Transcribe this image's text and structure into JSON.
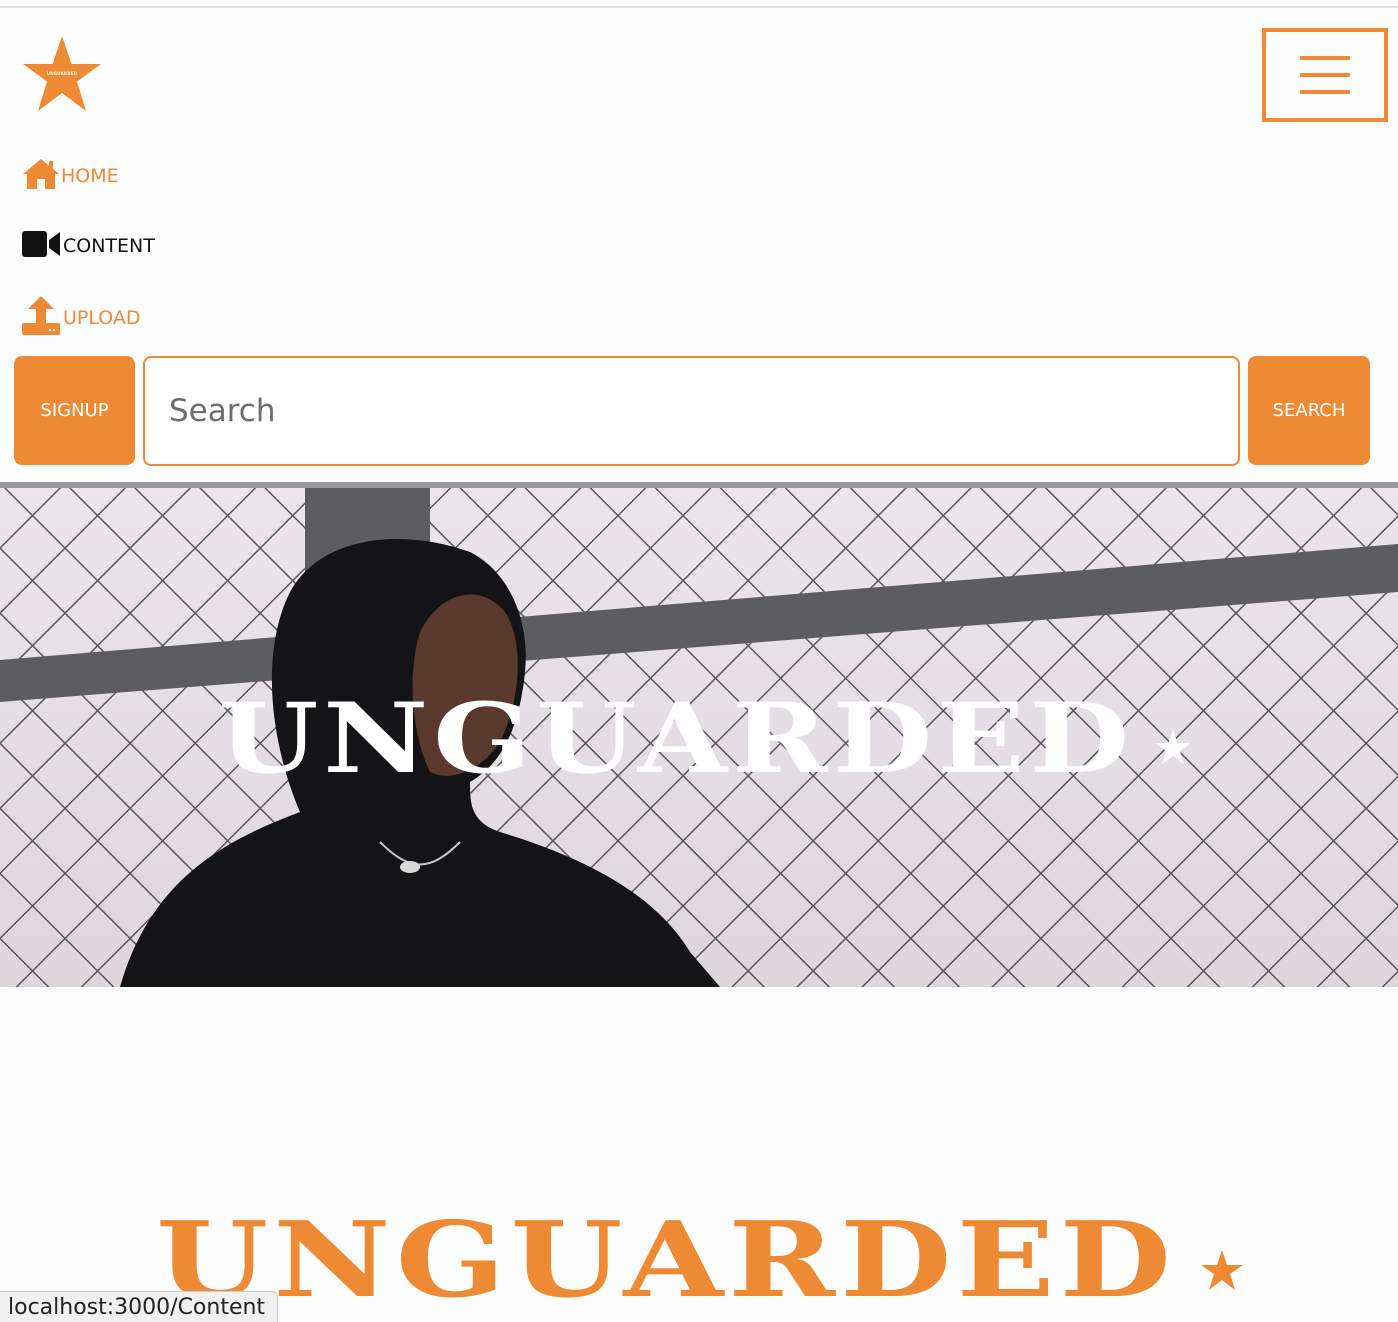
{
  "colors": {
    "accent": "#ee8a33",
    "text_dark": "#111111",
    "white": "#ffffff"
  },
  "header": {
    "logo": {
      "icon": "star-logo-icon",
      "text": "UNGUARDED"
    },
    "menu_toggle": {
      "icon": "hamburger-menu-icon"
    }
  },
  "nav": {
    "items": [
      {
        "label": "HOME",
        "icon": "home-icon"
      },
      {
        "label": "CONTENT",
        "icon": "video-camera-icon"
      },
      {
        "label": "UPLOAD",
        "icon": "upload-icon"
      }
    ]
  },
  "search": {
    "signup_label": "SIGNUP",
    "placeholder": "Search",
    "value": "",
    "search_label": "SEARCH"
  },
  "hero": {
    "title": "UNGUARDED",
    "image": "woman-by-chain-link-fence"
  },
  "brand_footer": {
    "title": "UNGUARDED"
  },
  "status_bar": {
    "url": "localhost:3000/Content"
  }
}
